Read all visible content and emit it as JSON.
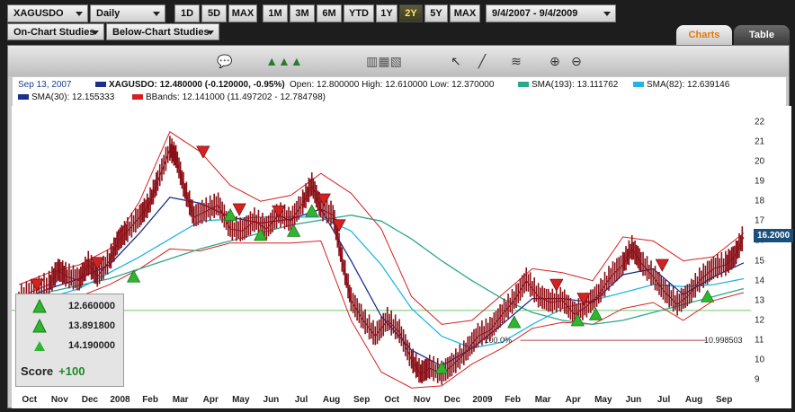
{
  "toolbar": {
    "symbol": "XAGUSDO",
    "interval": "Daily",
    "range_buttons_1": [
      "1D",
      "5D",
      "MAX"
    ],
    "range_buttons_2": [
      "1M",
      "3M",
      "6M",
      "YTD",
      "1Y",
      "2Y",
      "5Y",
      "MAX"
    ],
    "active_range": "2Y",
    "date_range": "9/4/2007 - 9/4/2009",
    "on_chart": "On-Chart Studies",
    "below_chart": "Below-Chart Studies",
    "tab_charts": "Charts",
    "tab_table": "Table"
  },
  "legend": {
    "date": "Sep 13, 2007",
    "symbol_line": "XAGUSDO: 12.480000 (-0.120000, -0.95%)",
    "ohlc": "Open: 12.800000  High: 12.610000  Low: 12.370000",
    "sma193": "SMA(193): 13.111762",
    "sma82": "SMA(82): 12.639146",
    "sma30": "SMA(30): 12.155333",
    "bbands": "BBands: 12.141000 (11.497202 - 12.784798)"
  },
  "colors": {
    "price": "#8b0f17",
    "sma193": "#2aa88a",
    "sma82": "#23b4e6",
    "sma30": "#1a2f8f",
    "bbands": "#d62020",
    "buy": "#2fb52f",
    "sell": "#d32222"
  },
  "score": {
    "values": [
      "12.660000",
      "13.891800",
      "14.190000"
    ],
    "label": "Score",
    "points": "+100"
  },
  "fib": {
    "label": "100.0%",
    "value": "10.998503"
  },
  "price_tag": "16.2000",
  "chart_data": {
    "type": "line",
    "ylim": [
      8.2,
      22.8
    ],
    "yticks": [
      9,
      10,
      11,
      12,
      13,
      14,
      15,
      16,
      17,
      18,
      19,
      20,
      21,
      22
    ],
    "xlabels": [
      "Oct",
      "Nov",
      "Dec",
      "2008",
      "Feb",
      "Mar",
      "Apr",
      "May",
      "Jun",
      "Jul",
      "Aug",
      "Sep",
      "Oct",
      "Nov",
      "Dec",
      "2009",
      "Feb",
      "Mar",
      "Apr",
      "May",
      "Jun",
      "Jul",
      "Aug",
      "Sep"
    ],
    "months": 24,
    "grid_y": 12.5,
    "price": [
      [
        0,
        13.1
      ],
      [
        0.5,
        13.5
      ],
      [
        1,
        13.8
      ],
      [
        1.3,
        14.5
      ],
      [
        1.6,
        14.2
      ],
      [
        2,
        14.0
      ],
      [
        2.3,
        14.8
      ],
      [
        2.6,
        14.2
      ],
      [
        3,
        15.0
      ],
      [
        3.3,
        16.0
      ],
      [
        3.6,
        16.5
      ],
      [
        4,
        17.2
      ],
      [
        4.3,
        17.8
      ],
      [
        4.6,
        19.0
      ],
      [
        5,
        20.6
      ],
      [
        5.2,
        20.2
      ],
      [
        5.5,
        18.5
      ],
      [
        5.8,
        17.2
      ],
      [
        6.2,
        17.5
      ],
      [
        6.6,
        17.8
      ],
      [
        7,
        16.6
      ],
      [
        7.4,
        16.5
      ],
      [
        7.8,
        17.0
      ],
      [
        8.2,
        16.6
      ],
      [
        8.6,
        17.3
      ],
      [
        9,
        17.0
      ],
      [
        9.4,
        17.9
      ],
      [
        9.7,
        18.8
      ],
      [
        10,
        17.6
      ],
      [
        10.4,
        17.3
      ],
      [
        10.7,
        15.0
      ],
      [
        11,
        13.0
      ],
      [
        11.4,
        12.0
      ],
      [
        11.8,
        11.2
      ],
      [
        12.2,
        12.0
      ],
      [
        12.6,
        11.4
      ],
      [
        13,
        10.0
      ],
      [
        13.3,
        9.3
      ],
      [
        13.6,
        9.6
      ],
      [
        14,
        9.3
      ],
      [
        14.4,
        9.8
      ],
      [
        14.8,
        10.4
      ],
      [
        15.2,
        11.2
      ],
      [
        15.6,
        11.5
      ],
      [
        16,
        12.3
      ],
      [
        16.4,
        13.0
      ],
      [
        16.8,
        14.0
      ],
      [
        17.2,
        13.2
      ],
      [
        17.6,
        12.9
      ],
      [
        18,
        13.0
      ],
      [
        18.4,
        12.3
      ],
      [
        18.8,
        12.7
      ],
      [
        19.2,
        13.3
      ],
      [
        19.6,
        14.2
      ],
      [
        20,
        14.8
      ],
      [
        20.3,
        15.6
      ],
      [
        20.6,
        14.9
      ],
      [
        21,
        14.2
      ],
      [
        21.4,
        13.4
      ],
      [
        21.8,
        12.8
      ],
      [
        22.2,
        13.3
      ],
      [
        22.6,
        14.1
      ],
      [
        23,
        14.6
      ],
      [
        23.4,
        14.8
      ],
      [
        23.7,
        15.2
      ],
      [
        24,
        16.2
      ]
    ],
    "sma30": [
      [
        0,
        13.0
      ],
      [
        1,
        13.6
      ],
      [
        2,
        14.1
      ],
      [
        3,
        14.8
      ],
      [
        4,
        16.4
      ],
      [
        5,
        18.2
      ],
      [
        6,
        17.9
      ],
      [
        7,
        17.2
      ],
      [
        8,
        16.9
      ],
      [
        9,
        17.1
      ],
      [
        10,
        17.6
      ],
      [
        11,
        15.0
      ],
      [
        12,
        12.2
      ],
      [
        13,
        10.5
      ],
      [
        14,
        9.7
      ],
      [
        15,
        10.6
      ],
      [
        16,
        11.8
      ],
      [
        17,
        13.1
      ],
      [
        18,
        13.1
      ],
      [
        19,
        12.9
      ],
      [
        20,
        14.3
      ],
      [
        21,
        14.6
      ],
      [
        22,
        13.3
      ],
      [
        23,
        14.2
      ],
      [
        24,
        14.9
      ]
    ],
    "sma82": [
      [
        0,
        12.7
      ],
      [
        2,
        13.6
      ],
      [
        4,
        15.2
      ],
      [
        6,
        17.0
      ],
      [
        8,
        17.2
      ],
      [
        10,
        17.2
      ],
      [
        11,
        16.5
      ],
      [
        12,
        14.8
      ],
      [
        13,
        12.6
      ],
      [
        14,
        11.2
      ],
      [
        15,
        10.6
      ],
      [
        16,
        10.9
      ],
      [
        17,
        11.8
      ],
      [
        18,
        12.6
      ],
      [
        19,
        13.0
      ],
      [
        20,
        13.4
      ],
      [
        21,
        13.8
      ],
      [
        22,
        13.7
      ],
      [
        23,
        13.8
      ],
      [
        24,
        14.1
      ]
    ],
    "sma193": [
      [
        0,
        13.1
      ],
      [
        3,
        14.1
      ],
      [
        6,
        15.6
      ],
      [
        9,
        16.8
      ],
      [
        11,
        17.3
      ],
      [
        12,
        17.0
      ],
      [
        13,
        16.1
      ],
      [
        14,
        15.0
      ],
      [
        15,
        14.0
      ],
      [
        16,
        13.1
      ],
      [
        17,
        12.4
      ],
      [
        18,
        12.0
      ],
      [
        19,
        11.8
      ],
      [
        20,
        12.0
      ],
      [
        21,
        12.4
      ],
      [
        22,
        12.8
      ],
      [
        23,
        13.2
      ],
      [
        24,
        13.6
      ]
    ],
    "bb_upper": [
      [
        0,
        13.8
      ],
      [
        1,
        14.4
      ],
      [
        2,
        14.8
      ],
      [
        3,
        15.6
      ],
      [
        4,
        18.0
      ],
      [
        5,
        21.5
      ],
      [
        6,
        20.5
      ],
      [
        7,
        18.8
      ],
      [
        8,
        18.0
      ],
      [
        9,
        18.3
      ],
      [
        10,
        19.4
      ],
      [
        11,
        18.4
      ],
      [
        12,
        16.6
      ],
      [
        13,
        13.2
      ],
      [
        14,
        11.8
      ],
      [
        15,
        12.0
      ],
      [
        16,
        13.3
      ],
      [
        17,
        14.6
      ],
      [
        18,
        14.4
      ],
      [
        19,
        14.0
      ],
      [
        20,
        16.2
      ],
      [
        21,
        16.0
      ],
      [
        22,
        15.0
      ],
      [
        23,
        15.2
      ],
      [
        24,
        16.4
      ]
    ],
    "bb_lower": [
      [
        0,
        12.3
      ],
      [
        1,
        12.8
      ],
      [
        2,
        13.2
      ],
      [
        3,
        13.8
      ],
      [
        4,
        14.6
      ],
      [
        5,
        15.6
      ],
      [
        6,
        15.5
      ],
      [
        7,
        15.9
      ],
      [
        8,
        15.9
      ],
      [
        9,
        15.9
      ],
      [
        10,
        16.0
      ],
      [
        11,
        12.0
      ],
      [
        12,
        9.4
      ],
      [
        13,
        8.6
      ],
      [
        14,
        8.7
      ],
      [
        15,
        9.8
      ],
      [
        16,
        10.6
      ],
      [
        17,
        11.6
      ],
      [
        18,
        11.9
      ],
      [
        19,
        11.8
      ],
      [
        20,
        12.6
      ],
      [
        21,
        12.9
      ],
      [
        22,
        12.0
      ],
      [
        23,
        13.0
      ],
      [
        24,
        13.4
      ]
    ],
    "buy_signals": [
      [
        0.2,
        13.0
      ],
      [
        3.8,
        14.2
      ],
      [
        7.0,
        17.3
      ],
      [
        8.0,
        16.3
      ],
      [
        9.1,
        16.5
      ],
      [
        9.7,
        17.5
      ],
      [
        14.0,
        9.6
      ],
      [
        16.4,
        11.9
      ],
      [
        18.5,
        12.0
      ],
      [
        19.1,
        12.3
      ],
      [
        22.8,
        13.2
      ]
    ],
    "sell_signals": [
      [
        0.6,
        13.8
      ],
      [
        2.6,
        14.9
      ],
      [
        6.1,
        20.5
      ],
      [
        7.3,
        17.6
      ],
      [
        8.6,
        17.5
      ],
      [
        10.1,
        18.1
      ],
      [
        10.6,
        16.8
      ],
      [
        17.8,
        13.8
      ],
      [
        18.7,
        13.1
      ],
      [
        21.3,
        14.8
      ]
    ]
  }
}
